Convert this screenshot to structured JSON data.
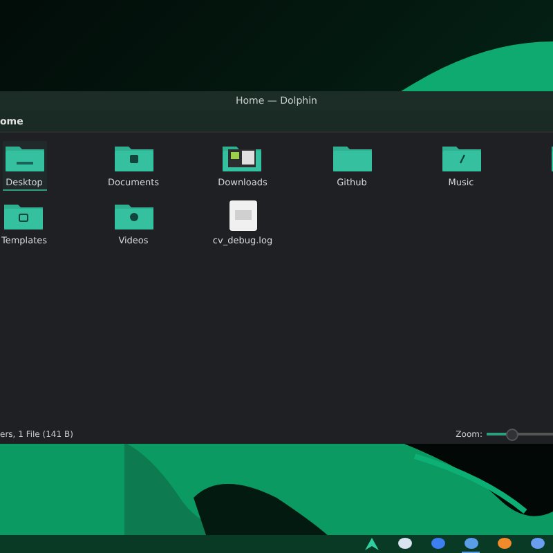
{
  "window": {
    "title": "Home — Dolphin"
  },
  "breadcrumb": "ome",
  "files": [
    {
      "name": "Desktop",
      "kind": "desktop",
      "selected": true
    },
    {
      "name": "Documents",
      "kind": "documents",
      "selected": false
    },
    {
      "name": "Downloads",
      "kind": "downloads",
      "selected": false
    },
    {
      "name": "Github",
      "kind": "folder",
      "selected": false
    },
    {
      "name": "Music",
      "kind": "music",
      "selected": false
    },
    {
      "kind": "folder",
      "selected": false
    },
    {
      "name": "Templates",
      "kind": "templates",
      "selected": false
    },
    {
      "name": "Videos",
      "kind": "videos",
      "selected": false
    },
    {
      "name": "cv_debug.log",
      "kind": "file",
      "selected": false
    }
  ],
  "status_bar": {
    "text": "ers, 1 File (141 B)",
    "zoom_label": "Zoom:",
    "zoom": {
      "level": 0.2
    }
  },
  "taskbar": {
    "items": [
      {
        "kind": "launcher",
        "active": false
      },
      {
        "kind": "app",
        "color": "#d8e4f0",
        "active": false
      },
      {
        "kind": "app",
        "color": "#3d7ef0",
        "active": false
      },
      {
        "kind": "app",
        "color": "#5b9ee8",
        "active": true
      },
      {
        "kind": "app",
        "color": "#f08a2a",
        "active": false
      },
      {
        "kind": "app",
        "color": "#6b9ef0",
        "active": false
      }
    ]
  }
}
